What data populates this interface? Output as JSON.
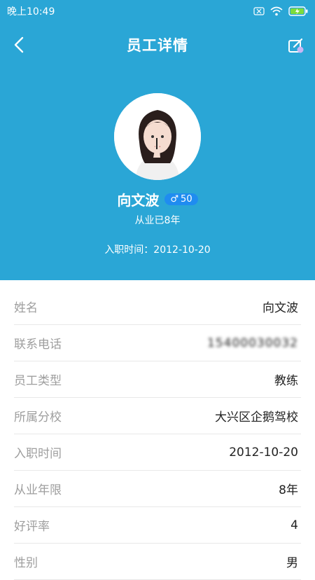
{
  "status_bar": {
    "time": "晚上10:49"
  },
  "nav": {
    "title": "员工详情"
  },
  "profile": {
    "name": "向文波",
    "gender_symbol": "♂",
    "age": "50",
    "years_in_industry": "从业已8年",
    "join_text": "入职时间：2012-10-20"
  },
  "details": [
    {
      "label": "姓名",
      "value": "向文波"
    },
    {
      "label": "联系电话",
      "value": "15400030032"
    },
    {
      "label": "员工类型",
      "value": "教练"
    },
    {
      "label": "所属分校",
      "value": "大兴区企鹅驾校"
    },
    {
      "label": "入职时间",
      "value": "2012-10-20"
    },
    {
      "label": "从业年限",
      "value": "8年"
    },
    {
      "label": "好评率",
      "value": "4"
    },
    {
      "label": "性别",
      "value": "男"
    }
  ]
}
